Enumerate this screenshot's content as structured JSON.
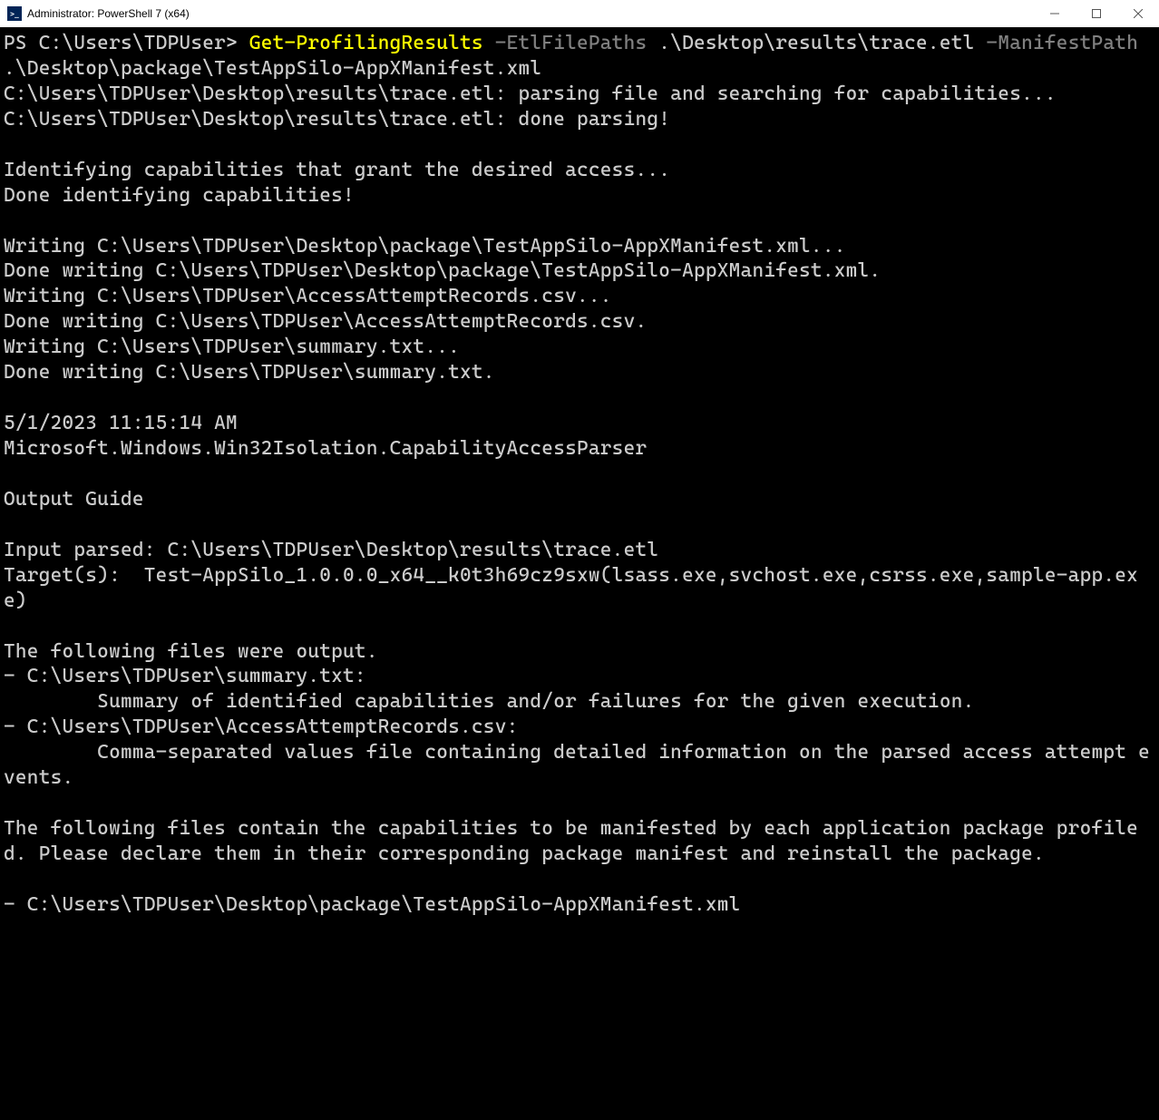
{
  "titlebar": {
    "title": "Administrator: PowerShell 7 (x64)"
  },
  "terminal": {
    "prompt": "PS C:\\Users\\TDPUser> ",
    "cmdlet": "Get-ProfilingResults",
    "param1": " -EtlFilePaths ",
    "arg1": ".\\Desktop\\results\\trace.etl ",
    "param2": "-ManifestPath ",
    "arg2": ".\\Desktop\\package\\TestAppSilo-AppXManifest.xml",
    "output": "C:\\Users\\TDPUser\\Desktop\\results\\trace.etl: parsing file and searching for capabilities...\nC:\\Users\\TDPUser\\Desktop\\results\\trace.etl: done parsing!\n\nIdentifying capabilities that grant the desired access...\nDone identifying capabilities!\n\nWriting C:\\Users\\TDPUser\\Desktop\\package\\TestAppSilo-AppXManifest.xml...\nDone writing C:\\Users\\TDPUser\\Desktop\\package\\TestAppSilo-AppXManifest.xml.\nWriting C:\\Users\\TDPUser\\AccessAttemptRecords.csv...\nDone writing C:\\Users\\TDPUser\\AccessAttemptRecords.csv.\nWriting C:\\Users\\TDPUser\\summary.txt...\nDone writing C:\\Users\\TDPUser\\summary.txt.\n\n5/1/2023 11:15:14 AM\nMicrosoft.Windows.Win32Isolation.CapabilityAccessParser\n\nOutput Guide\n\nInput parsed: C:\\Users\\TDPUser\\Desktop\\results\\trace.etl\nTarget(s):  Test-AppSilo_1.0.0.0_x64__k0t3h69cz9sxw(lsass.exe,svchost.exe,csrss.exe,sample-app.exe)\n\nThe following files were output.\n- C:\\Users\\TDPUser\\summary.txt:\n        Summary of identified capabilities and/or failures for the given execution.\n- C:\\Users\\TDPUser\\AccessAttemptRecords.csv:\n        Comma-separated values file containing detailed information on the parsed access attempt events.\n\nThe following files contain the capabilities to be manifested by each application package profiled. Please declare them in their corresponding package manifest and reinstall the package.\n\n- C:\\Users\\TDPUser\\Desktop\\package\\TestAppSilo-AppXManifest.xml"
  }
}
